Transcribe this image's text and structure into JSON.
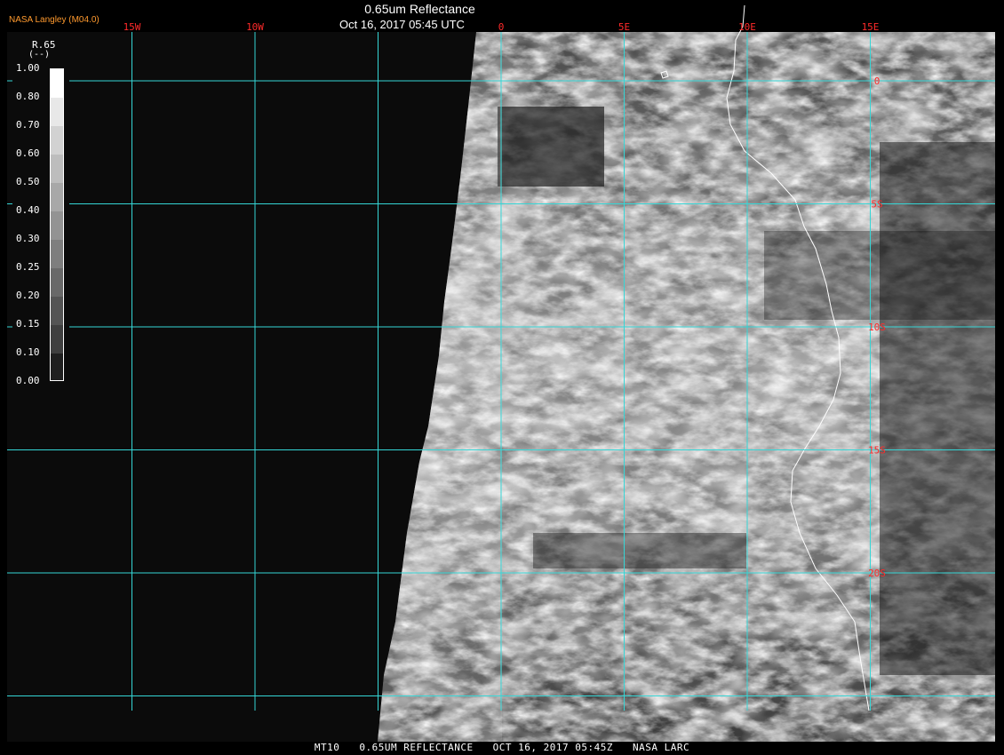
{
  "header": {
    "title": "0.65um Reflectance",
    "datetime": "Oct 16, 2017 05:45 UTC",
    "source": "NASA Langley (M04.0)"
  },
  "legend": {
    "title": "R.65",
    "units": "(--)",
    "ticks": [
      "1.00",
      "0.80",
      "0.70",
      "0.60",
      "0.50",
      "0.40",
      "0.30",
      "0.25",
      "0.20",
      "0.15",
      "0.10",
      "0.00"
    ],
    "swatches": [
      "#ffffff",
      "#e8e8e8",
      "#d2d2d2",
      "#bdbdbd",
      "#a8a8a8",
      "#939393",
      "#7e7e7e",
      "#696969",
      "#545454",
      "#3f3f3f",
      "#1f1f1f"
    ]
  },
  "map": {
    "lon_labels": [
      {
        "label": "15W",
        "lon": -15
      },
      {
        "label": "10W",
        "lon": -10
      },
      {
        "label": "0",
        "lon": 0
      },
      {
        "label": "5E",
        "lon": 5
      },
      {
        "label": "10E",
        "lon": 10
      },
      {
        "label": "15E",
        "lon": 15
      }
    ],
    "lat_labels": [
      {
        "label": "0",
        "lat": 0
      },
      {
        "label": "5S",
        "lat": -5
      },
      {
        "label": "10S",
        "lat": -10
      },
      {
        "label": "15S",
        "lat": -15
      },
      {
        "label": "20S",
        "lat": -20
      }
    ],
    "grid_lons": [
      -15,
      -10,
      -5,
      0,
      5,
      10,
      15
    ],
    "grid_lats": [
      0,
      -5,
      -10,
      -15,
      -20,
      -25
    ],
    "colors": {
      "grid": "#35d6d6",
      "label": "#ff2a2a",
      "coast": "#ffffff",
      "space": "#0b0b0b"
    }
  },
  "footer": {
    "sat": "MT10",
    "product": "0.65UM REFLECTANCE",
    "datetime": "OCT 16, 2017 05:45Z",
    "org": "NASA LARC"
  }
}
